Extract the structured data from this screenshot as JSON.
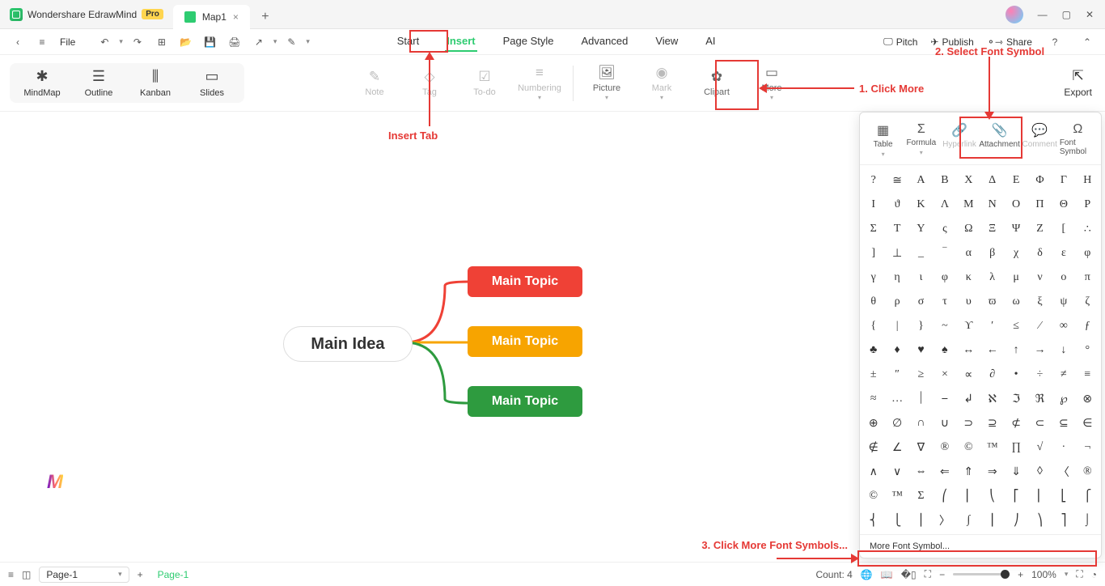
{
  "title": {
    "app": "Wondershare EdrawMind",
    "pro": "Pro",
    "doc": "Map1"
  },
  "quick": {
    "file": "File"
  },
  "maintabs": {
    "start": "Start",
    "insert": "Insert",
    "pagestyle": "Page Style",
    "advanced": "Advanced",
    "view": "View",
    "ai": "AI"
  },
  "rightq": {
    "pitch": "Pitch",
    "publish": "Publish",
    "share": "Share"
  },
  "views": {
    "mindmap": "MindMap",
    "outline": "Outline",
    "kanban": "Kanban",
    "slides": "Slides"
  },
  "ribbon": {
    "note": "Note",
    "tag": "Tag",
    "todo": "To-do",
    "numbering": "Numbering",
    "picture": "Picture",
    "mark": "Mark",
    "clipart": "Clipart",
    "more": "More",
    "export": "Export"
  },
  "morepanel": {
    "table": "Table",
    "formula": "Formula",
    "hyperlink": "Hyperlink",
    "attachment": "Attachment",
    "comment": "Comment",
    "fontsymbol": "Font Symbol",
    "moreLink": "More Font Symbol..."
  },
  "mind": {
    "idea": "Main Idea",
    "t1": "Main Topic",
    "t2": "Main Topic",
    "t3": "Main Topic"
  },
  "status": {
    "page": "Page-1",
    "pageTab": "Page-1",
    "count": "Count: 4",
    "zoom": "100%"
  },
  "anno": {
    "a1": "1. Click More",
    "a2": "2. Select Font Symbol",
    "a3": "3. Click More Font Symbols...",
    "insertTab": "Insert Tab"
  },
  "symbols": [
    "?",
    "≅",
    "Α",
    "Β",
    "Χ",
    "Δ",
    "Ε",
    "Φ",
    "Γ",
    "Η",
    "Ι",
    "ϑ",
    "Κ",
    "Λ",
    "Μ",
    "Ν",
    "Ο",
    "Π",
    "Θ",
    "Ρ",
    "Σ",
    "Τ",
    "Υ",
    "ς",
    "Ω",
    "Ξ",
    "Ψ",
    "Ζ",
    "[",
    "∴",
    "]",
    "⊥",
    "_",
    "‾",
    "α",
    "β",
    "χ",
    "δ",
    "ε",
    "φ",
    "γ",
    "η",
    "ι",
    "φ",
    "κ",
    "λ",
    "μ",
    "ν",
    "ο",
    "π",
    "θ",
    "ρ",
    "σ",
    "τ",
    "υ",
    "ϖ",
    "ω",
    "ξ",
    "ψ",
    "ζ",
    "{",
    "|",
    "}",
    "~",
    "ϒ",
    "′",
    "≤",
    "⁄",
    "∞",
    "ƒ",
    "♣",
    "♦",
    "♥",
    "♠",
    "↔",
    "←",
    "↑",
    "→",
    "↓",
    "°",
    "±",
    "″",
    "≥",
    "×",
    "∝",
    "∂",
    "•",
    "÷",
    "≠",
    "≡",
    "≈",
    "…",
    "⏐",
    "⎯",
    "↲",
    "ℵ",
    "ℑ",
    "ℜ",
    "℘",
    "⊗",
    "⊕",
    "∅",
    "∩",
    "∪",
    "⊃",
    "⊇",
    "⊄",
    "⊂",
    "⊆",
    "∈",
    "∉",
    "∠",
    "∇",
    "®",
    "©",
    "™",
    "∏",
    "√",
    "·",
    "¬",
    "∧",
    "∨",
    "⇔",
    "⇐",
    "⇑",
    "⇒",
    "⇓",
    "◊",
    "〈",
    "®",
    "©",
    "™",
    "Σ",
    "⎛",
    "⎜",
    "⎝",
    "⎡",
    "⎢",
    "⎣",
    "⎧",
    "⎨",
    "⎩",
    "⎪",
    "〉",
    "∫",
    "⎮",
    "⎠",
    "⎞",
    "⎤",
    "⌡",
    "⎫",
    "⎬",
    "⎩",
    "⎭",
    "⎦",
    "⎞",
    "⎠",
    "⎥",
    "⎭",
    "⎬",
    "⎫",
    "⎟"
  ]
}
